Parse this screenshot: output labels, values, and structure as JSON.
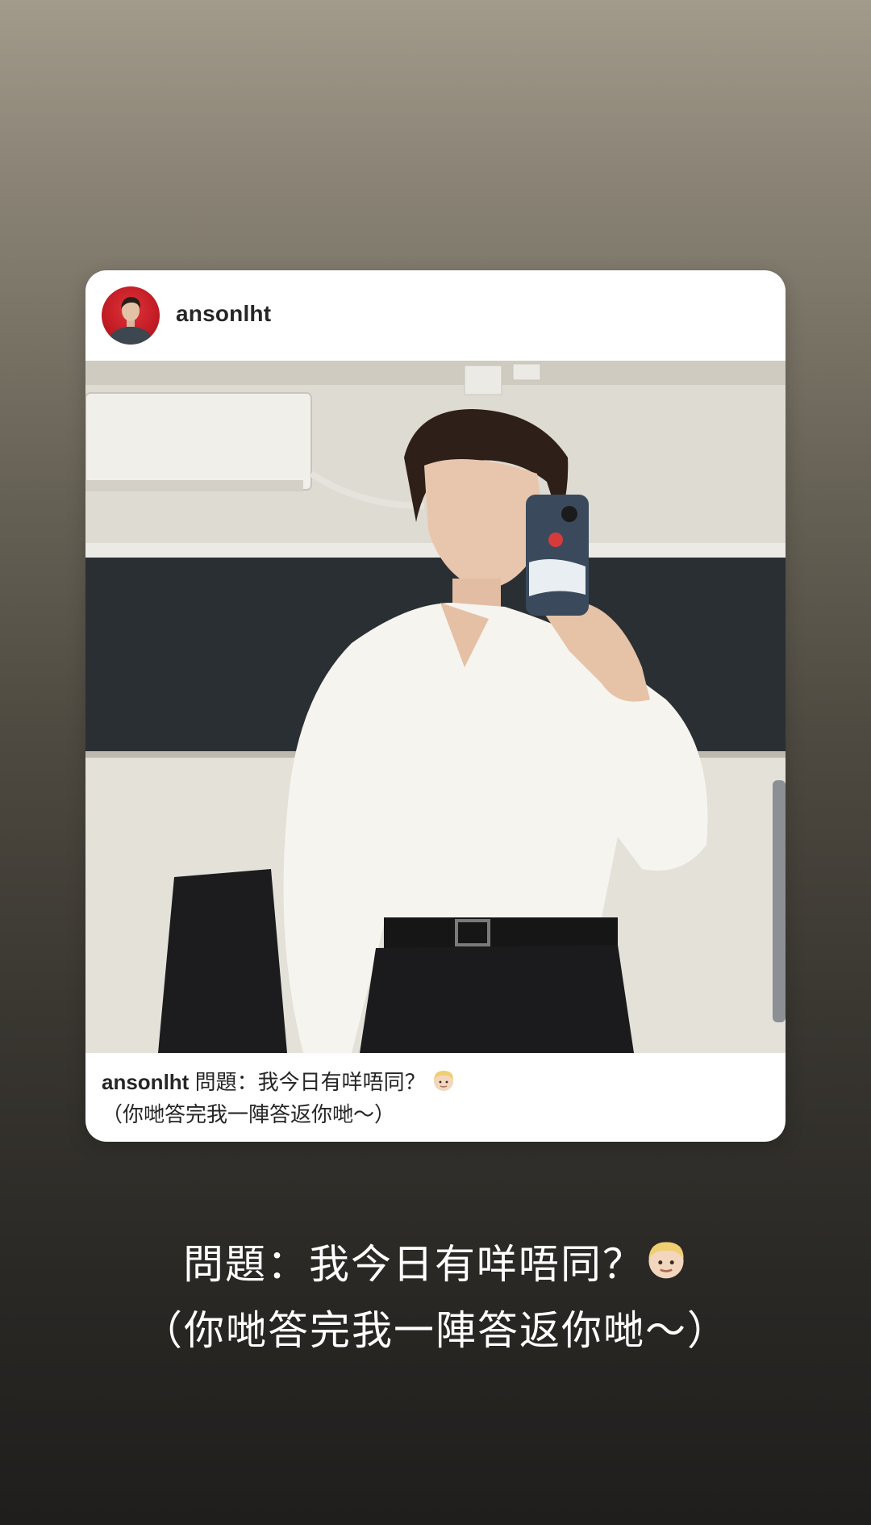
{
  "post": {
    "username": "ansonlht",
    "caption_user": "ansonlht",
    "caption_line1": "問題：我今日有咩唔同？",
    "caption_line2": "（你哋答完我一陣答返你哋～）",
    "caption_emoji": "blond-person-emoji"
  },
  "story_text": {
    "line1": "問題：我今日有咩唔同？",
    "line2": "（你哋答完我一陣答返你哋～）",
    "emoji": "blond-person-emoji"
  },
  "colors": {
    "background_top": "#a29a8b",
    "background_bottom": "#1f1e1c",
    "avatar_bg": "#c41d26",
    "card_bg": "#ffffff",
    "text_dark": "#262626"
  }
}
